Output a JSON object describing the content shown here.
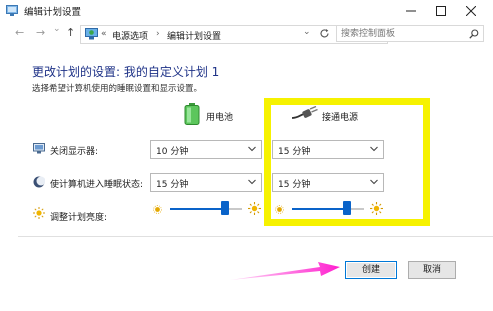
{
  "window": {
    "title": "编辑计划设置"
  },
  "nav": {
    "back_glyph": "←",
    "forward_glyph": "→",
    "recent_glyph": "⌄",
    "up_glyph": "↑"
  },
  "address": {
    "overflow": "«",
    "crumbs": [
      "电源选项",
      "编辑计划设置"
    ],
    "separator": "›",
    "dropdown_glyph": "⌄"
  },
  "search": {
    "placeholder": "搜索控制面板"
  },
  "page": {
    "title": "更改计划的设置: 我的自定义计划 1",
    "subtitle": "选择希望计算机使用的睡眠设置和显示设置。"
  },
  "columns": {
    "battery": "用电池",
    "plugged": "接通电源"
  },
  "settings": {
    "display_off": {
      "label": "关闭显示器:",
      "battery": "10 分钟",
      "plugged": "15 分钟"
    },
    "sleep": {
      "label": "使计算机进入睡眠状态:",
      "battery": "15 分钟",
      "plugged": "15 分钟"
    },
    "brightness": {
      "label": "调整计划亮度:",
      "battery_level_pct": 80,
      "plugged_level_pct": 80
    }
  },
  "buttons": {
    "create": "创建",
    "cancel": "取消"
  },
  "colors": {
    "title_blue": "#1e3287",
    "accent": "#0a63c9",
    "highlight_yellow": "#f6f200",
    "arrow_magenta": "#ff1fcf"
  }
}
